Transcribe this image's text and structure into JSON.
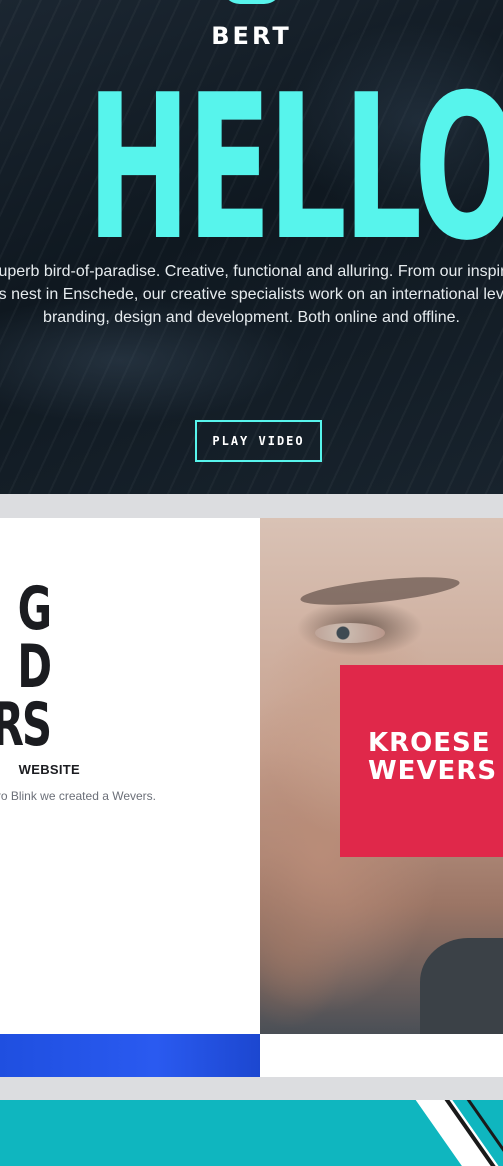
{
  "hero": {
    "brand": "BERT",
    "headline": "HELLO",
    "description": "A superb bird-of-paradise. Creative, functional and alluring. From our inspiring bird's nest in Enschede, our creative specialists work on an international level at branding, design and development. Both online and offline.",
    "play_button": "PLAY VIDEO",
    "accent_color": "#57f4ec"
  },
  "case": {
    "title_lines": [
      "G",
      "D",
      "RS"
    ],
    "subtitle": "WEBSITE",
    "description": "me for change. Even we all with Buro Blink we created a Wevers.",
    "brand_lines": [
      "KROESE",
      "WEVERS"
    ],
    "brand_color": "#e0284a",
    "bottom_bar_color": "#2a5af0"
  },
  "next_section": {
    "color": "#0fb6bf"
  }
}
